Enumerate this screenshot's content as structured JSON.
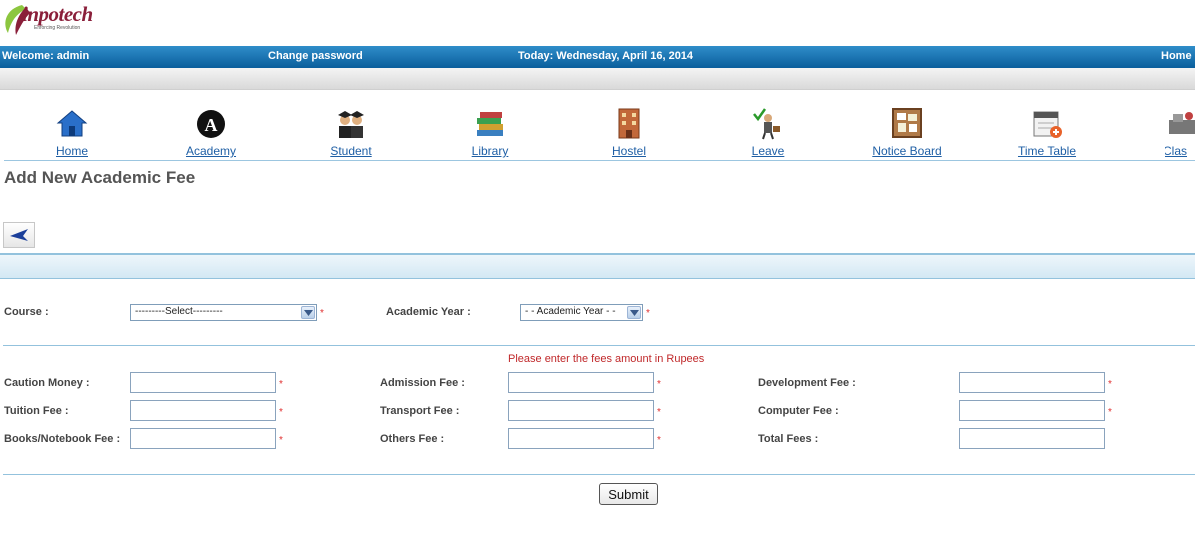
{
  "logo": {
    "text": "inpotech",
    "tagline": "Enforcing Revolution"
  },
  "topbar": {
    "welcome": "Welcome: admin",
    "change_password": "Change password",
    "today": "Today: Wednesday, April 16, 2014",
    "home": "Home"
  },
  "nav": [
    {
      "label": "Home",
      "icon": "house-icon"
    },
    {
      "label": "Academy",
      "icon": "academy-icon"
    },
    {
      "label": "Student",
      "icon": "graduates-icon"
    },
    {
      "label": "Library",
      "icon": "books-icon"
    },
    {
      "label": "Hostel",
      "icon": "building-icon"
    },
    {
      "label": "Leave",
      "icon": "leave-person-icon"
    },
    {
      "label": "Notice Board",
      "icon": "corkboard-icon"
    },
    {
      "label": "Time Table",
      "icon": "calendar-icon"
    },
    {
      "label": "Clas",
      "icon": "classroom-icon"
    }
  ],
  "page_title": "Add New Academic Fee",
  "back_button": {
    "icon": "back-arrow-icon"
  },
  "course": {
    "label": "Course :",
    "selected": "---------Select---------"
  },
  "academic_year": {
    "label": "Academic Year :",
    "selected": "- - Academic Year - -"
  },
  "hint": "Please enter the fees amount in Rupees",
  "fields": {
    "caution_money": {
      "label": "Caution Money :",
      "value": ""
    },
    "admission_fee": {
      "label": "Admission Fee :",
      "value": ""
    },
    "development_fee": {
      "label": "Development Fee :",
      "value": ""
    },
    "tuition_fee": {
      "label": "Tuition Fee :",
      "value": ""
    },
    "transport_fee": {
      "label": "Transport Fee :",
      "value": ""
    },
    "computer_fee": {
      "label": "Computer Fee :",
      "value": ""
    },
    "books_fee": {
      "label": "Books/Notebook Fee :",
      "value": ""
    },
    "others_fee": {
      "label": "Others Fee :",
      "value": ""
    },
    "total_fees": {
      "label": "Total Fees :",
      "value": ""
    }
  },
  "required_mark": "*",
  "submit_label": "Submit",
  "colors": {
    "topbar": "#0a5e9c",
    "link": "#1f5fa5",
    "required": "#e03030",
    "hint": "#c0282a"
  }
}
